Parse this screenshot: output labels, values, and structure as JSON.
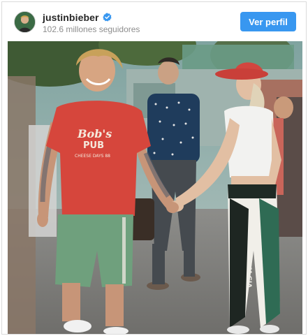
{
  "post": {
    "username": "justinbieber",
    "followers": "102.6 millones seguidores",
    "follow_button": "Ver perfil",
    "verified_icon": "verified-badge-icon",
    "accent_color": "#3897f0"
  },
  "photo": {
    "shirt_text_line1": "Bob's",
    "shirt_text_line2": "PUB",
    "shirt_text_line3": "CHEESE DAYS 88",
    "pants_text": "I AM GIA"
  }
}
